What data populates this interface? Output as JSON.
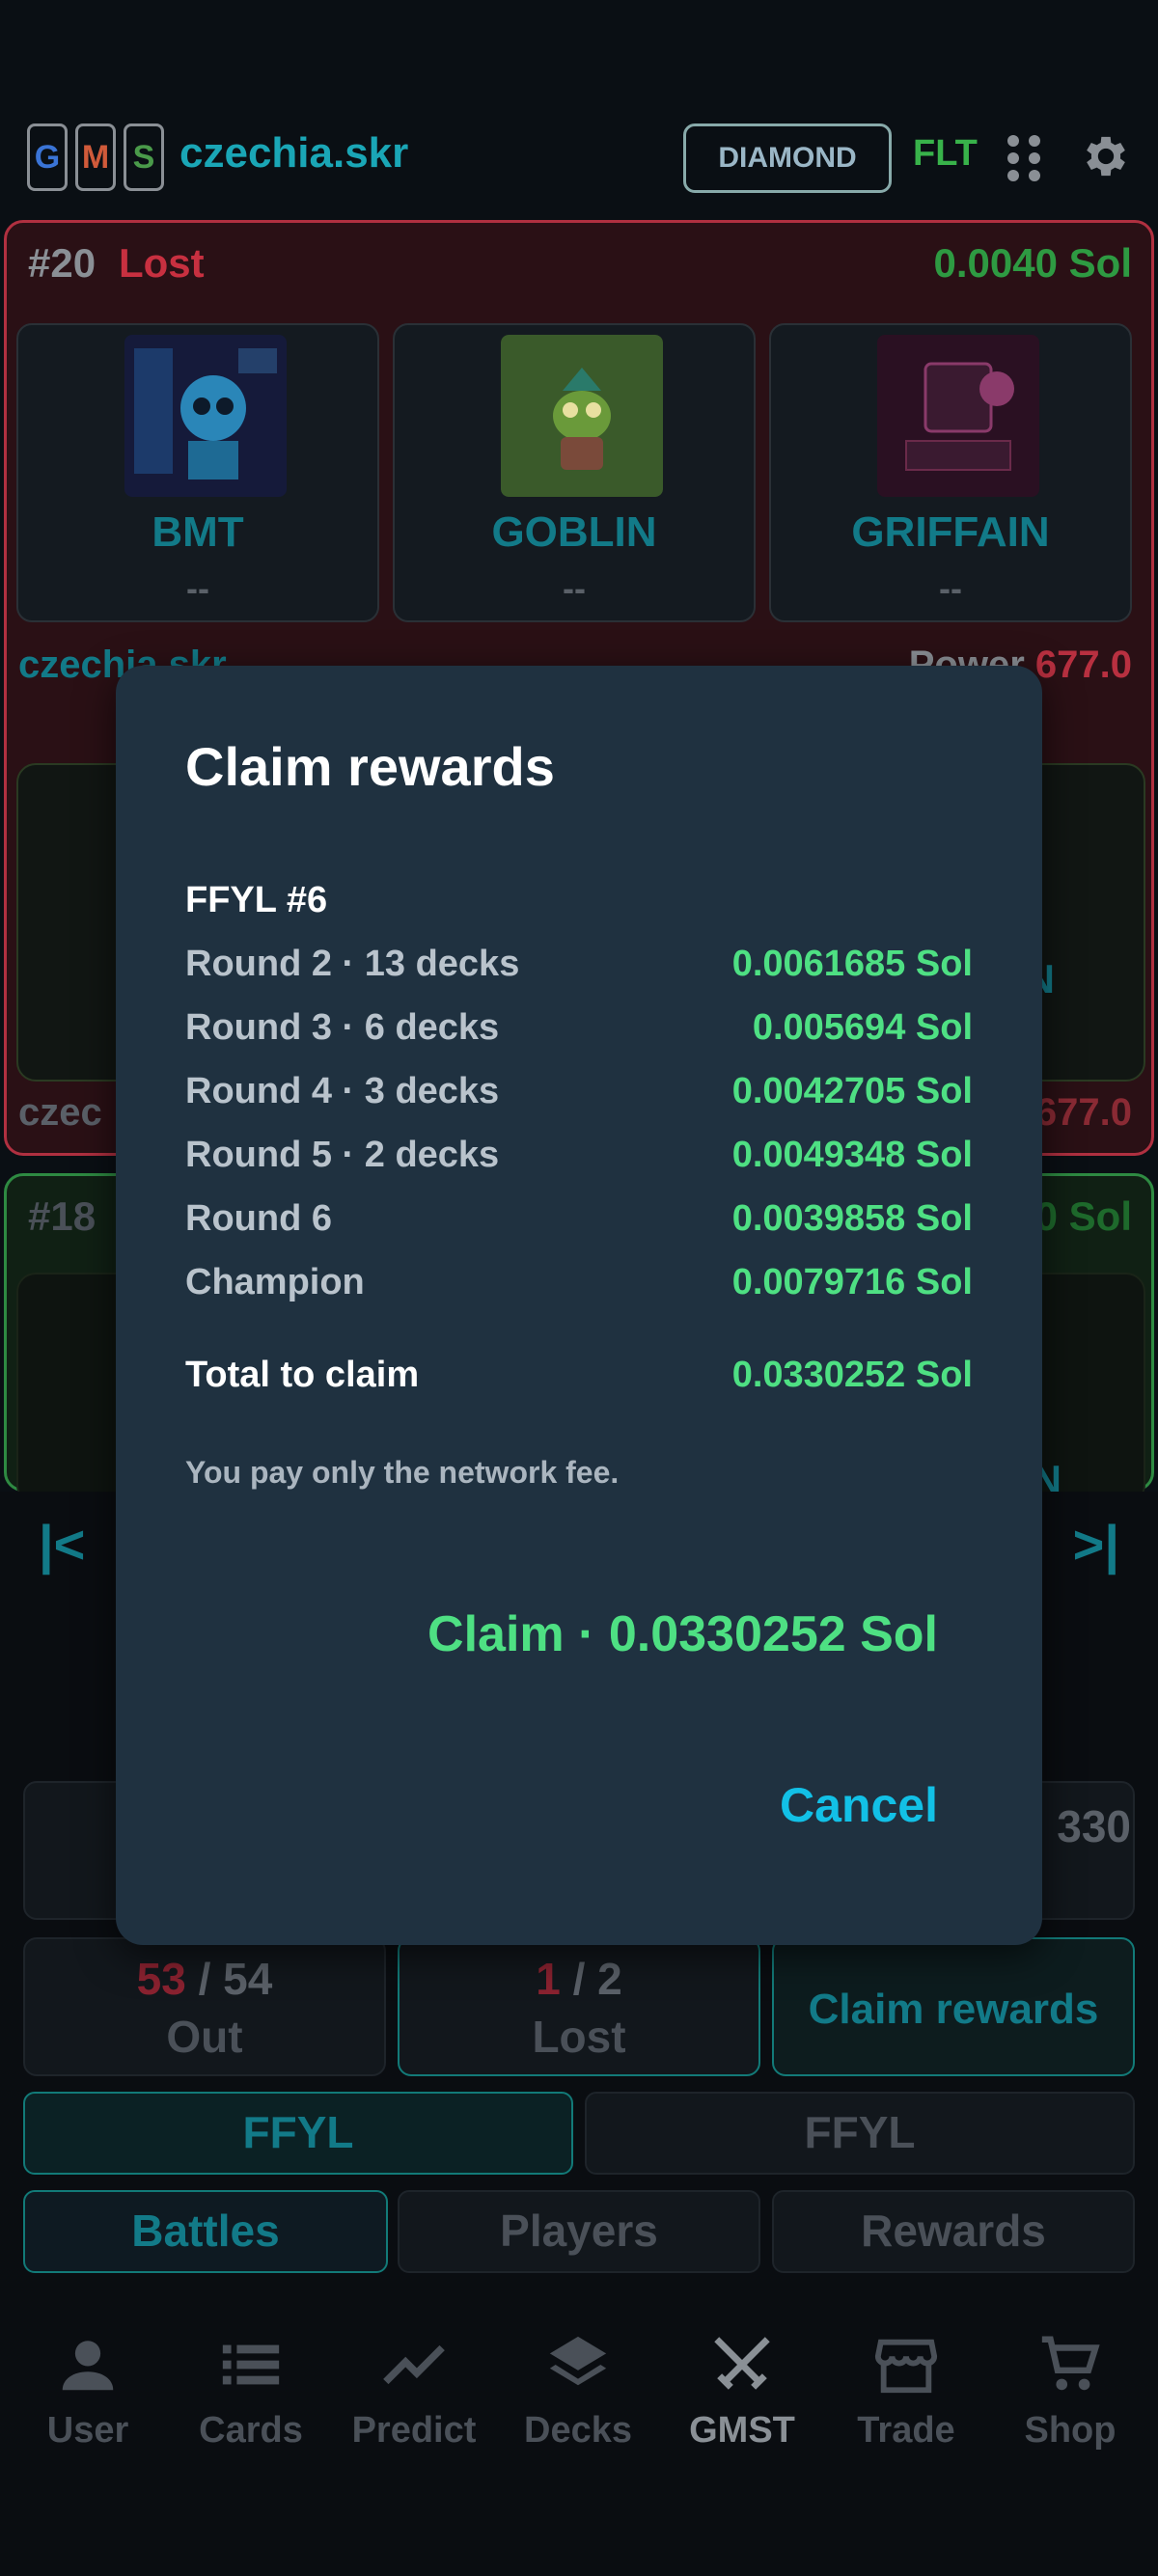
{
  "header": {
    "logo_letters": [
      "G",
      "M",
      "S"
    ],
    "username": "czechia.skr",
    "tier": "DIAMOND",
    "currency": "FLT",
    "icons": [
      "grid-icon",
      "gear-icon"
    ]
  },
  "battle1": {
    "number": "#20",
    "result": "Lost",
    "amount": "0.0040 Sol",
    "tokens": [
      {
        "name": "BMT",
        "score": "--",
        "icon": "robot-token-icon"
      },
      {
        "name": "GOBLIN",
        "score": "--",
        "icon": "goblin-token-icon"
      },
      {
        "name": "GRIFFAIN",
        "score": "--",
        "icon": "agent-engine-token-icon"
      }
    ],
    "owner": "czechia.skr",
    "power_label": "Power",
    "power_value": "677.0",
    "owner2": "czec",
    "power2": "677.0",
    "edge_text": "N"
  },
  "battle3": {
    "number": "#18",
    "amount": "0 Sol",
    "edge_text": "N"
  },
  "pager": {
    "first": "|<",
    "last": ">|"
  },
  "stats": {
    "partial_value": "330",
    "out": {
      "current": "53",
      "total": "54",
      "label": "Out"
    },
    "lost": {
      "current": "1",
      "total": "2",
      "label": "Lost"
    },
    "claim": "Claim rewards"
  },
  "modes": [
    "FFYL",
    "FFYL"
  ],
  "segments": [
    "Battles",
    "Players",
    "Rewards"
  ],
  "bottom_nav": [
    {
      "label": "User",
      "icon": "user-icon"
    },
    {
      "label": "Cards",
      "icon": "list-icon"
    },
    {
      "label": "Predict",
      "icon": "trend-icon"
    },
    {
      "label": "Decks",
      "icon": "layers-icon"
    },
    {
      "label": "GMST",
      "icon": "swords-icon"
    },
    {
      "label": "Trade",
      "icon": "store-icon"
    },
    {
      "label": "Shop",
      "icon": "cart-icon"
    }
  ],
  "dialog": {
    "title": "Claim rewards",
    "section": "FFYL #6",
    "rows": [
      {
        "label": "Round 2 · 13 decks",
        "value": "0.0061685 Sol"
      },
      {
        "label": "Round 3 · 6 decks",
        "value": "0.005694 Sol"
      },
      {
        "label": "Round 4 · 3 decks",
        "value": "0.0042705 Sol"
      },
      {
        "label": "Round 5 · 2 decks",
        "value": "0.0049348 Sol"
      },
      {
        "label": "Round 6",
        "value": "0.0039858 Sol"
      },
      {
        "label": "Champion",
        "value": "0.0079716 Sol"
      }
    ],
    "total_label": "Total to claim",
    "total_value": "0.0330252 Sol",
    "note": "You pay only the network fee.",
    "claim_button": "Claim · 0.0330252 Sol",
    "cancel_button": "Cancel"
  },
  "colors": {
    "accent": "#4ee083",
    "cancel": "#12c0e6",
    "dialog_bg": "#1f3140",
    "lost": "#c83040",
    "teal": "#127a88"
  }
}
